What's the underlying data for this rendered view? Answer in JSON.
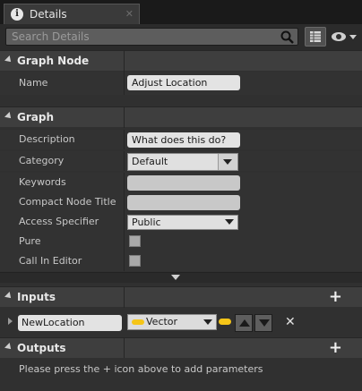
{
  "tab": {
    "icon": "info-icon",
    "label": "Details",
    "close": "✕"
  },
  "search": {
    "placeholder": "Search Details"
  },
  "sections": {
    "graph_node": {
      "title": "Graph Node",
      "name_label": "Name",
      "name_value": "Adjust Location"
    },
    "graph": {
      "title": "Graph",
      "description_label": "Description",
      "description_value": "What does this do?",
      "category_label": "Category",
      "category_value": "Default",
      "keywords_label": "Keywords",
      "keywords_value": "",
      "compact_label": "Compact Node Title",
      "compact_value": "",
      "access_label": "Access Specifier",
      "access_value": "Public",
      "pure_label": "Pure",
      "pure_checked": false,
      "call_in_editor_label": "Call In Editor",
      "call_in_editor_checked": false
    },
    "inputs": {
      "title": "Inputs",
      "param_name": "NewLocation",
      "param_type": "Vector",
      "pin_color": "#f5c518"
    },
    "outputs": {
      "title": "Outputs",
      "hint": "Please press the + icon above to add parameters"
    }
  },
  "colors": {
    "panel_bg": "#303030",
    "header_bg": "#3e3e3e",
    "vector_pin": "#f5c518"
  }
}
